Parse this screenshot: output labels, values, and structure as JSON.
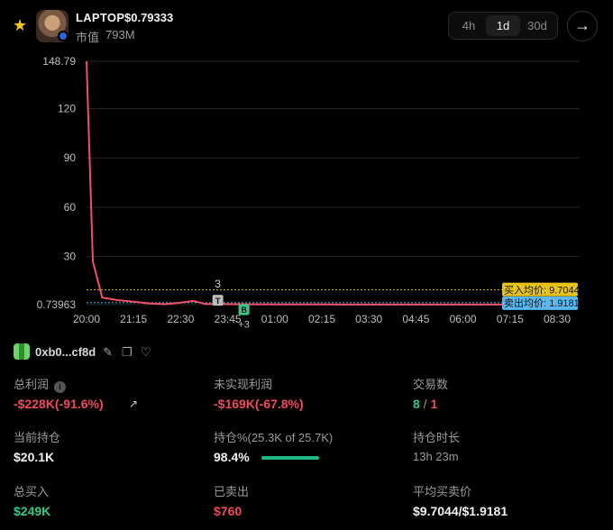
{
  "header": {
    "token_name": "LAPTOP",
    "price": "$0.79333",
    "market_cap_label": "市值",
    "market_cap_value": "793M",
    "ranges": [
      "4h",
      "1d",
      "30d"
    ],
    "active_range": "1d"
  },
  "chart_data": {
    "type": "line",
    "y_ticks": [
      "148.79",
      "120",
      "90",
      "60",
      "30",
      "0.73963"
    ],
    "x_ticks": [
      "20:00",
      "21:15",
      "22:30",
      "23:45",
      "01:00",
      "02:15",
      "03:30",
      "04:45",
      "06:00",
      "07:15",
      "08:30"
    ],
    "ylim": [
      0.73963,
      148.79
    ],
    "series": [
      {
        "x": [
          "20:00",
          "20:10",
          "20:25",
          "20:50",
          "21:15",
          "21:40",
          "22:05",
          "22:30",
          "22:50",
          "23:10",
          "23:45",
          "01:00",
          "02:15",
          "03:30",
          "04:45",
          "06:00",
          "07:15",
          "08:30",
          "09:00"
        ],
        "values": [
          148.79,
          27,
          5,
          3.5,
          2.5,
          1.5,
          1.0,
          2.0,
          3.0,
          1.2,
          1.0,
          0.9,
          0.85,
          0.8,
          0.8,
          0.78,
          0.8,
          0.79,
          0.79
        ]
      }
    ],
    "buy_avg": 9.7044,
    "sell_avg": 1.9181,
    "buy_avg_label": "买入均价: 9.7044",
    "sell_avg_label": "卖出均价: 1.9181",
    "marker_t_count": "3",
    "marker_b_count": "+3",
    "marker_t": "T",
    "marker_b": "B"
  },
  "wallet": {
    "address": "0xb0...cf8d"
  },
  "stats": {
    "total_profit_label": "总利润",
    "total_profit_value": "-$228K(-91.6%)",
    "unrealized_label": "未实现利润",
    "unrealized_value": "-$169K(-67.8%)",
    "trades_label": "交易数",
    "trades_buy": "8",
    "trades_sep": " / ",
    "trades_sell": "1",
    "holding_label": "当前持仓",
    "holding_value": "$20.1K",
    "holding_pct_label": "持仓%(25.3K of 25.7K)",
    "holding_pct_value": "98.4%",
    "holding_pct": 0.984,
    "hold_time_label": "持仓时长",
    "hold_time_value": "13h 23m",
    "total_buy_label": "总买入",
    "total_buy_value": "$249K",
    "sold_label": "已卖出",
    "sold_value": "$760",
    "avg_price_label": "平均买卖价",
    "avg_price_value": "$9.7044/$1.9181"
  },
  "colors": {
    "line": "#f0506a",
    "buy_avg": "#e8c419",
    "sell_avg": "#5ab8f0",
    "red": "#f04a5c",
    "green": "#2fc98a"
  }
}
